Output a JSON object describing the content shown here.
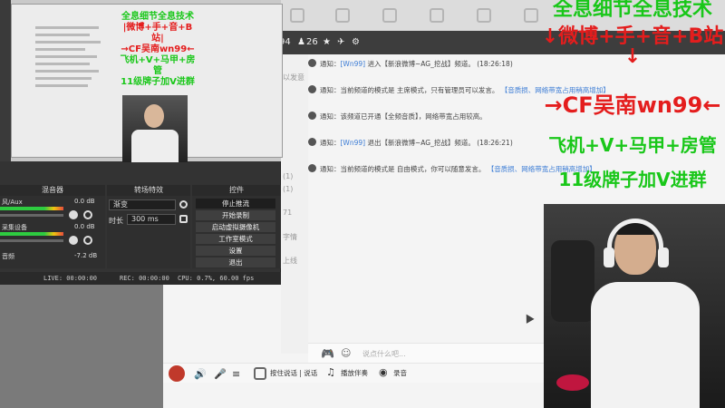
{
  "chat": {
    "subbar": {
      "count1": "94",
      "count2": "26"
    },
    "left_fragments": [
      "以发意",
      "(1)",
      "(1)",
      "71",
      "字情",
      "上线"
    ],
    "messages": [
      {
        "label": "通知：",
        "name": "[Wn99]",
        "text": "进入【新浪微博~AG_挖战】频道。",
        "time": "(18:26:18)"
      },
      {
        "label": "通知：",
        "name": "",
        "text": "当前频道的模式是 主席模式，只有管理员可以发言。",
        "tag": "【音质损、网络带宽占用稍高增加】",
        "time": ""
      },
      {
        "label": "通知：",
        "name": "",
        "text": "该频道已开通【全频音质】，网络带宽占用较高。",
        "time": ""
      },
      {
        "label": "通知：",
        "name": "[Wn99]",
        "text": "退出【新浪微博~AG_挖战】频道。",
        "time": "(18:26:21)"
      },
      {
        "label": "通知：",
        "name": "",
        "text": "当前频道的模式是 自由模式，你可以随意发言。",
        "tag": "【音质损、网络带宽占用稍高增加】",
        "time": ""
      }
    ],
    "input_placeholder": "说点什么吧...",
    "bottom": {
      "hold_to_talk": "按住说话 | 说话",
      "play_music": "播放伴奏",
      "record": "录音"
    }
  },
  "obs": {
    "preview_overlay": [
      "全息细节全息技术",
      "|微博+手+音+B站|",
      "→CF吴南wn99←",
      "飞机+V+马甲+房管",
      "11级牌子加V进群"
    ],
    "panels": {
      "mixer": "混音器",
      "transitions": "转场特效",
      "controls": "控件"
    },
    "mixer_channels": [
      {
        "label": "风/Aux",
        "value": "0.0 dB"
      },
      {
        "label": "采集设备",
        "value": "0.0 dB"
      },
      {
        "label": "音频",
        "value": "-7.2 dB"
      }
    ],
    "transition": {
      "selected": "渐变",
      "duration_label": "时长",
      "duration_value": "300 ms"
    },
    "controls": [
      "停止推流",
      "开始录制",
      "启动虚拟摄像机",
      "工作室模式",
      "设置",
      "退出"
    ],
    "status": {
      "live": "LIVE: 00:00:00",
      "rec": "REC: 00:00:00",
      "cpu": "CPU: 0.7%, 60.00 fps"
    }
  },
  "overlay": {
    "line1": "全息细节全息技术",
    "line2": "↓微博+手+音+B站↓",
    "line3": "→CF吴南wn99←",
    "line4": "飞机+V+马甲+房管",
    "line5": "11级牌子加V进群"
  }
}
